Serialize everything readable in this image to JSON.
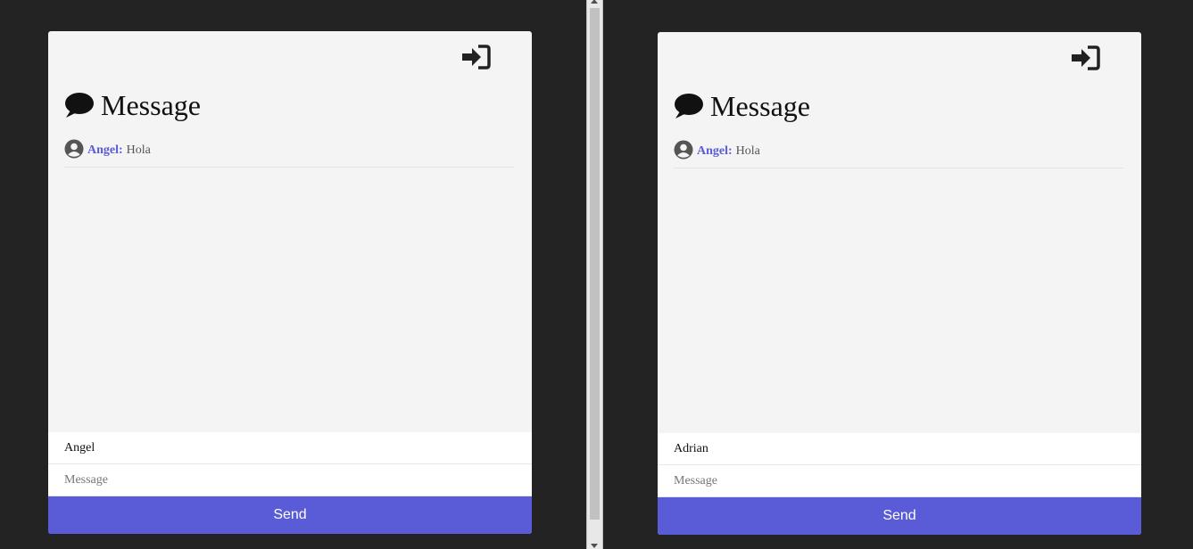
{
  "colors": {
    "accent": "#5a5bd6",
    "page_bg": "#232323",
    "card_bg": "#f4f4f4"
  },
  "windows": [
    {
      "title": "Message",
      "messages": [
        {
          "author": "Angel:",
          "text": "Hola"
        }
      ],
      "username_value": "Angel",
      "message_placeholder": "Message",
      "send_label": "Send"
    },
    {
      "title": "Message",
      "messages": [
        {
          "author": "Angel:",
          "text": "Hola"
        }
      ],
      "username_value": "Adrian",
      "message_placeholder": "Message",
      "send_label": "Send"
    }
  ],
  "icons": {
    "login": "sign-in-icon",
    "title": "comment-icon",
    "avatar": "user-circle-icon"
  }
}
